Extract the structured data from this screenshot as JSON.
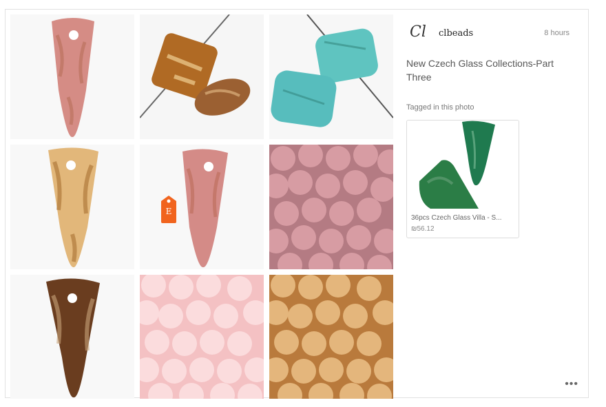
{
  "post": {
    "shop_logo": "Cl",
    "shop_name": "clbeads",
    "time": "8 hours",
    "title": "New Czech Glass Collections-Part Three",
    "tagged_label": "Tagged in this photo",
    "more": "•••"
  },
  "product": {
    "name": "36pcs Czech Glass Villa - S...",
    "price": "₪56.12"
  },
  "badge": {
    "letter": "E",
    "color": "#f1641e"
  },
  "colors": {
    "text": "#555555",
    "border": "#e1e1e1"
  }
}
